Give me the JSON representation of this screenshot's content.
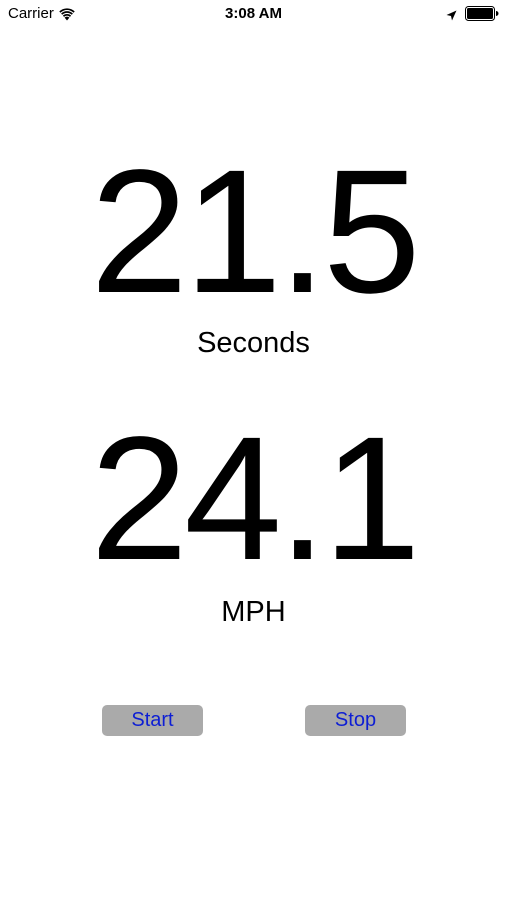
{
  "status_bar": {
    "carrier": "Carrier",
    "time": "3:08 AM",
    "icons": [
      "wifi-icon",
      "location-icon",
      "battery-icon"
    ]
  },
  "timer": {
    "value": "21.5",
    "unit": "Seconds"
  },
  "speed": {
    "value": "24.1",
    "unit": "MPH"
  },
  "controls": {
    "start_label": "Start",
    "stop_label": "Stop"
  },
  "colors": {
    "button_background": "#aaaaaa",
    "button_text": "#0d1ed4",
    "text": "#000000",
    "background": "#ffffff"
  }
}
